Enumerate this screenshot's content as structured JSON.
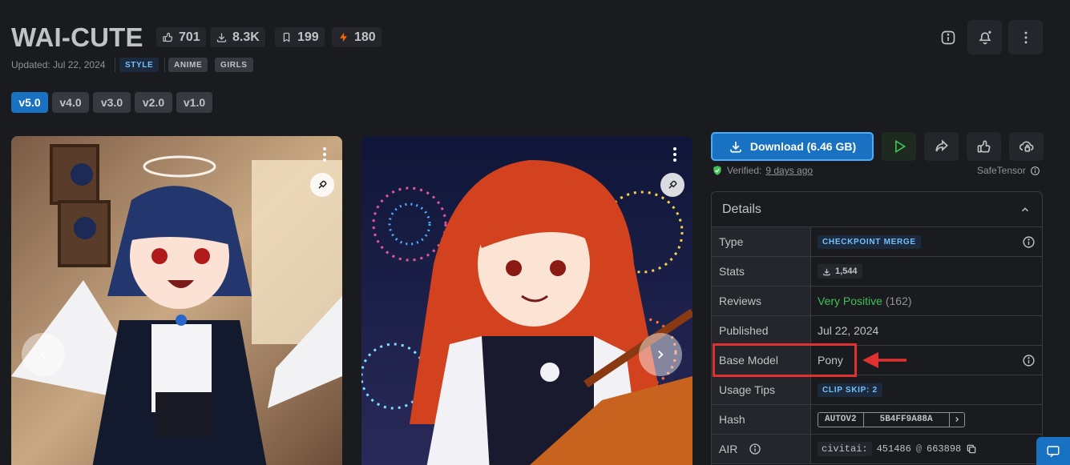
{
  "header": {
    "title": "WAI-CUTE",
    "stats": {
      "likes": "701",
      "downloads": "8.3K",
      "bookmarks": "199",
      "buzz": "180"
    },
    "updated": "Updated: Jul 22, 2024",
    "tags": [
      "STYLE",
      "ANIME",
      "GIRLS"
    ]
  },
  "versions": [
    "v5.0",
    "v4.0",
    "v3.0",
    "v2.0",
    "v1.0"
  ],
  "active_version": "v5.0",
  "actions": {
    "download_label": "Download (6.46 GB)",
    "verified_label": "Verified:",
    "verified_ago": "9 days ago",
    "safetensor": "SafeTensor"
  },
  "details": {
    "title": "Details",
    "rows": {
      "type": {
        "label": "Type",
        "value": "CHECKPOINT MERGE"
      },
      "stats": {
        "label": "Stats",
        "value": "1,544"
      },
      "reviews": {
        "label": "Reviews",
        "value": "Very Positive",
        "count": "(162)"
      },
      "published": {
        "label": "Published",
        "value": "Jul 22, 2024"
      },
      "base_model": {
        "label": "Base Model",
        "value": "Pony"
      },
      "usage_tips": {
        "label": "Usage Tips",
        "value": "CLIP SKIP: 2"
      },
      "hash": {
        "label": "Hash",
        "algo": "AUTOV2",
        "value": "5B4FF9A88A"
      },
      "air": {
        "label": "AIR",
        "prefix": "civitai:",
        "model_id": "451486",
        "at": "@",
        "version_id": "663898"
      }
    }
  },
  "colors": {
    "accent": "#1971c2",
    "highlight": "#e03131",
    "positive": "#40c057",
    "background": "#1a1b1e"
  },
  "icons": [
    "thumb-up-icon",
    "download-icon",
    "bookmark-icon",
    "bolt-icon",
    "info-icon",
    "bell-plus-icon",
    "kebab-icon",
    "play-icon",
    "share-icon",
    "cloud-lock-icon",
    "shield-check-icon",
    "chevron-up-icon",
    "copy-icon",
    "chat-icon",
    "remix-icon",
    "chevron-left-icon",
    "chevron-right-icon",
    "arrow-left-icon"
  ]
}
